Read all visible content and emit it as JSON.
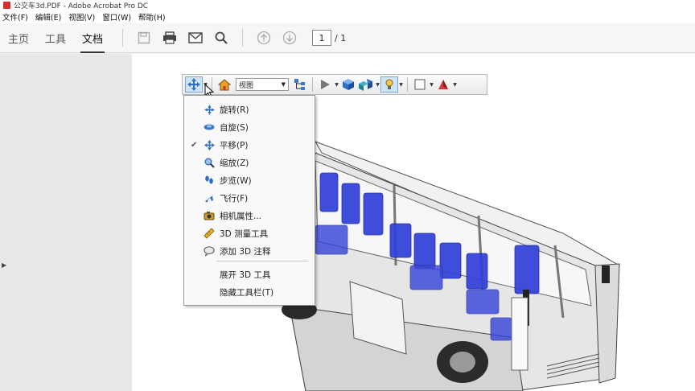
{
  "window": {
    "title": "公交车3d.PDF - Adobe Acrobat Pro DC"
  },
  "menubar": {
    "items": [
      "文件(F)",
      "编辑(E)",
      "视图(V)",
      "窗口(W)",
      "帮助(H)"
    ]
  },
  "toolbar": {
    "tabs": [
      "主页",
      "工具",
      "文档"
    ],
    "active_tab": "文档",
    "page_current": "1",
    "page_total": "/ 1"
  },
  "toolbar3d": {
    "view_select": "视图"
  },
  "menu3d": {
    "items": [
      {
        "label": "旋转(R)",
        "icon": "rotate-icon",
        "checked": false
      },
      {
        "label": "自旋(S)",
        "icon": "spin-icon",
        "checked": false
      },
      {
        "label": "平移(P)",
        "icon": "pan-icon",
        "checked": true
      },
      {
        "label": "缩放(Z)",
        "icon": "zoom-icon",
        "checked": false
      },
      {
        "label": "步览(W)",
        "icon": "walk-icon",
        "checked": false
      },
      {
        "label": "飞行(F)",
        "icon": "fly-icon",
        "checked": false
      },
      {
        "label": "相机属性...",
        "icon": "camera-icon",
        "checked": false
      },
      {
        "label": "3D 测量工具",
        "icon": "ruler-icon",
        "checked": false
      },
      {
        "label": "添加 3D 注释",
        "icon": "comment-icon",
        "checked": false
      },
      {
        "label": "展开 3D 工具",
        "icon": "",
        "checked": false
      },
      {
        "label": "隐藏工具栏(T)",
        "icon": "",
        "checked": false
      }
    ]
  },
  "colors": {
    "seat_blue": "#2f3fd8",
    "accent": "#3b78c8"
  }
}
